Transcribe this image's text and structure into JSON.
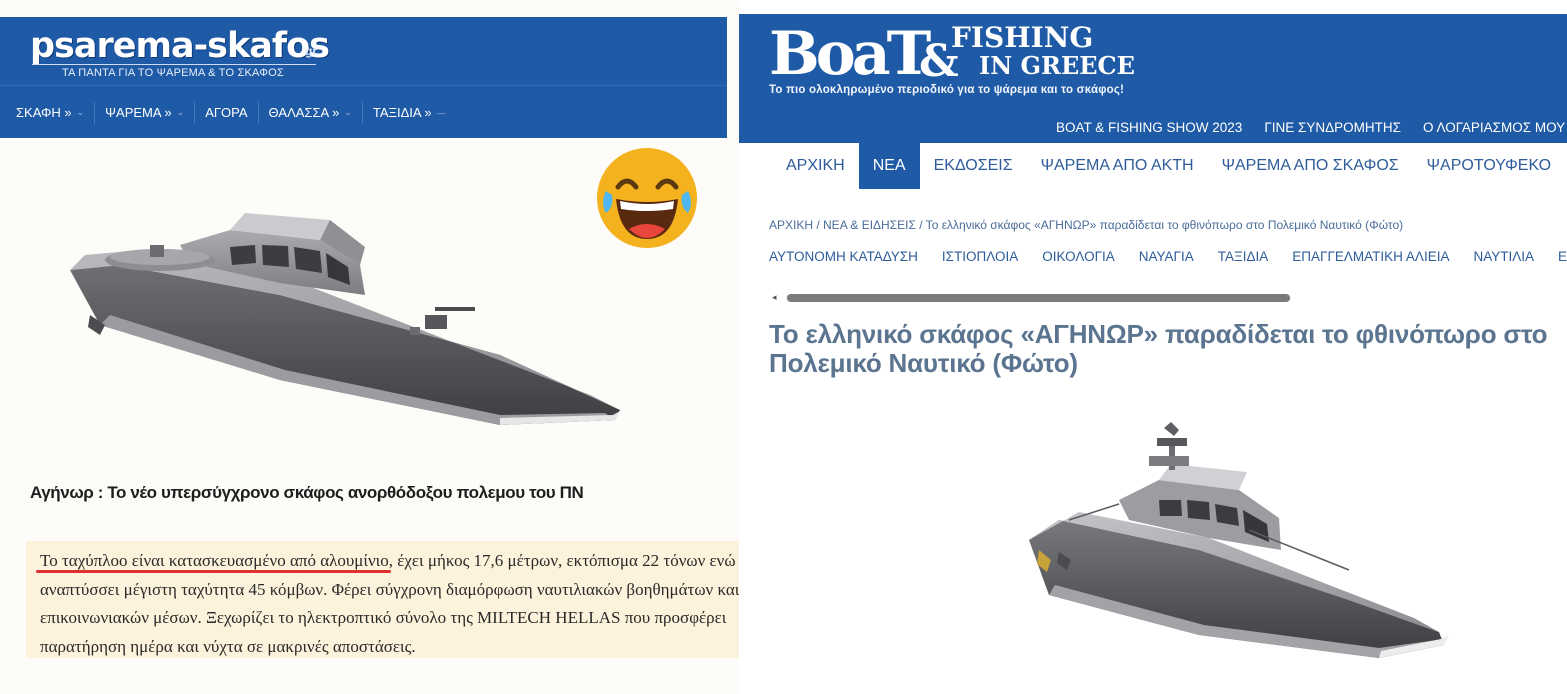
{
  "left_site": {
    "logo": "psarema-skafos",
    "logo_tld": "gr",
    "tagline": "ΤΑ ΠΑΝΤΑ ΓΙΑ ΤΟ ΨΑΡΕΜΑ & ΤΟ ΣΚΑΦΟΣ",
    "nav": [
      {
        "label": "ΣΚΑΦΗ »",
        "chevron": "⌄"
      },
      {
        "label": "ΨΑΡΕΜΑ »",
        "chevron": "⌄"
      },
      {
        "label": "ΑΓΟΡΑ",
        "chevron": ""
      },
      {
        "label": "ΘΑΛΑΣΣΑ »",
        "chevron": "⌄"
      },
      {
        "label": "ΤΑΞΙΔΙΑ »",
        "chevron": "—"
      }
    ],
    "article_title": "Αγήνωρ : Το νέο υπερσύγχρονο σκάφος ανορθόδοξου πολεμου του ΠΝ",
    "excerpt_highlight": "Το ταχύπλοο είναι κατασκευασμένο από αλουμίνιο",
    "excerpt_rest": ", έχει μήκος 17,6 μέτρων, εκτόπισμα 22 τόνων ενώ αναπτύσσει μέγιστη ταχύτητα 45 κόμβων. Φέρει σύγχρονη διαμόρφωση ναυτιλιακών βοηθημάτων και επικοινωνιακών μέσων. Ξεχωρίζει το ηλεκτροπτικό σύνολο της MILTECH HELLAS που προσφέρει παρατήρηση ημέρα και νύχτα σε μακρινές αποστάσεις.",
    "emoji_icon": "laughing-tears-emoji-icon",
    "highlight_color": "#fdf2db",
    "underline_color": "#e03131"
  },
  "right_site": {
    "logo_main": "BoaT",
    "logo_amp": "&",
    "logo_fishing": "FISHING",
    "logo_ingreece": "IN GREECE",
    "tagline": "Το πιο ολοκληρωμένο περιοδικό για το ψάρεμα και το σκάφος!",
    "top_nav": [
      "BOAT & FISHING SHOW 2023",
      "ΓΙΝΕ ΣΥΝΔΡΟΜΗΤΗΣ",
      "Ο ΛΟΓΑΡΙΑΣΜΟΣ ΜΟΥ"
    ],
    "menu": [
      {
        "label": "ΑΡΧΙΚΗ",
        "active": false
      },
      {
        "label": "ΝΕΑ",
        "active": true
      },
      {
        "label": "ΕΚΔΟΣΕΙΣ",
        "active": false
      },
      {
        "label": "ΨΑΡΕΜΑ ΑΠΟ ΑΚΤΗ",
        "active": false
      },
      {
        "label": "ΨΑΡΕΜΑ ΑΠΟ ΣΚΑΦΟΣ",
        "active": false
      },
      {
        "label": "ΨΑΡΟΤΟΥΦΕΚΟ",
        "active": false
      }
    ],
    "breadcrumb": "ΑΡΧΙΚΗ / ΝΕΑ & ΕΙΔΗΣΕΙΣ / Το ελληνικό σκάφος «ΑΓΗΝΩΡ» παραδίδεται το φθινόπωρο στο Πολεμικό Ναυτικό (Φώτο)",
    "categories": [
      "ΑΥΤΟΝΟΜΗ ΚΑΤΑΔΥΣΗ",
      "ΙΣΤΙΟΠΛΟΙΑ",
      "ΟΙΚΟΛΟΓΙΑ",
      "ΝΑΥΑΓΙΑ",
      "ΤΑΞΙΔΙΑ",
      "ΕΠΑΓΓΕΛΜΑΤΙΚΗ ΑΛΙΕΙΑ",
      "ΝΑΥΤΙΛΙΑ",
      "Ε"
    ],
    "scroll_arrow": "◂",
    "article_title": "Το ελληνικό σκάφος «ΑΓΗΝΩΡ» παραδίδεται το φθινόπωρο στο Πολεμικό Ναυτικό (Φώτο)",
    "brand_color": "#1f5aa6"
  }
}
